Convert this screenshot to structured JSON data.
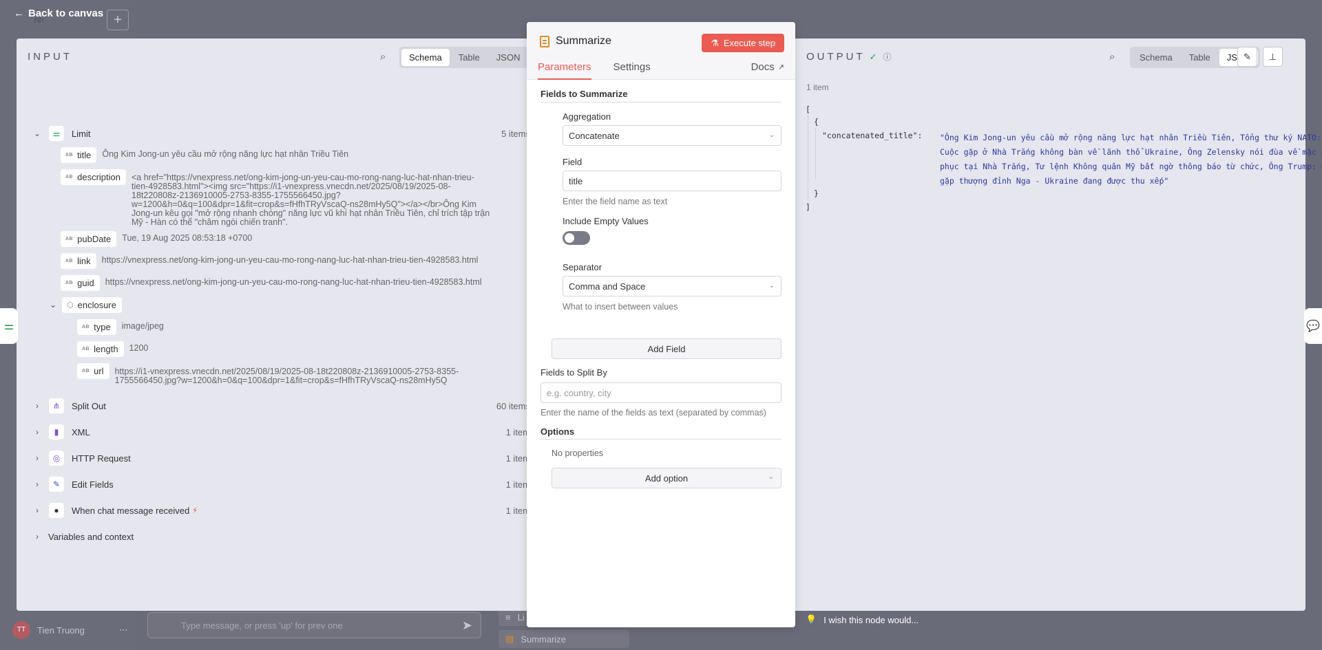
{
  "nav": {
    "back_label": "Back to canvas"
  },
  "background": {
    "left_panel_fragment": "nh",
    "user_name": "Tien Truong",
    "user_initials": "TT",
    "chat_placeholder": "Type message, or press 'up' for prev one",
    "bottom_node_1": "Li",
    "bottom_node_2": "Summarize",
    "wish_text": "I wish this node would..."
  },
  "input": {
    "title": "INPUT",
    "views": [
      "Schema",
      "Table",
      "JSON"
    ],
    "active_view": "Schema",
    "limit": {
      "label": "Limit",
      "count": "5 items"
    },
    "fields": {
      "title": {
        "name": "title",
        "value": "Ông Kim Jong-un yêu cầu mở rộng năng lực hạt nhân Triều Tiên"
      },
      "description": {
        "name": "description",
        "lines": [
          "<a href=\"https://vnexpress.net/ong-kim-jong-un-yeu-cau-mo-rong-nang-luc-hat-nhan-trieu-",
          "tien-4928583.html\"><img src=\"https://i1-vnexpress.vnecdn.net/2025/08/19/2025-08-",
          "18t220808z-2136910005-2753-8355-1755566450.jpg?",
          "w=1200&h=0&q=100&dpr=1&fit=crop&s=fHfhTRyVscaQ-ns28mHy5Q\"></a></br>Ông Kim",
          "Jong-un kêu gọi \"mở rộng nhanh chóng\" năng lực vũ khí hạt nhân Triều Tiên, chỉ trích tập trận",
          "Mỹ - Hàn có thể \"châm ngòi chiến tranh\"."
        ]
      },
      "pubDate": {
        "name": "pubDate",
        "value": "Tue, 19 Aug 2025 08:53:18 +0700"
      },
      "link": {
        "name": "link",
        "value": "https://vnexpress.net/ong-kim-jong-un-yeu-cau-mo-rong-nang-luc-hat-nhan-trieu-tien-4928583.html"
      },
      "guid": {
        "name": "guid",
        "value": "https://vnexpress.net/ong-kim-jong-un-yeu-cau-mo-rong-nang-luc-hat-nhan-trieu-tien-4928583.html"
      },
      "enclosure": {
        "name": "enclosure"
      },
      "type": {
        "name": "type",
        "value": "image/jpeg"
      },
      "length": {
        "name": "length",
        "value": "1200"
      },
      "url": {
        "name": "url",
        "line1": "https://i1-vnexpress.vnecdn.net/2025/08/19/2025-08-18t220808z-2136910005-2753-8355-",
        "line2": "1755566450.jpg?w=1200&h=0&q=100&dpr=1&fit=crop&s=fHfhTRyVscaQ-ns28mHy5Q"
      }
    },
    "nodes": [
      {
        "label": "Split Out",
        "count": "60 items"
      },
      {
        "label": "XML",
        "count": "1 item"
      },
      {
        "label": "HTTP Request",
        "count": "1 item"
      },
      {
        "label": "Edit Fields",
        "count": "1 item"
      },
      {
        "label": "When chat message received",
        "count": "1 item"
      },
      {
        "label": "Variables and context",
        "count": ""
      }
    ],
    "colors": {
      "limit": "#1b9a52",
      "split_out": "#7d4fd6",
      "xml": "#7d4fd6",
      "http": "#7d4fd6",
      "edit": "#3c4fd6",
      "chat": "#333333",
      "trigger": "#ea5c52"
    }
  },
  "params": {
    "node_title": "Summarize",
    "execute_label": "Execute step",
    "tabs": [
      "Parameters",
      "Settings"
    ],
    "docs_label": "Docs",
    "fields_to_summarize": "Fields to Summarize",
    "aggregation_label": "Aggregation",
    "aggregation_value": "Concatenate",
    "field_label": "Field",
    "field_value": "title",
    "field_hint": "Enter the field name as text",
    "include_empty_label": "Include Empty Values",
    "include_empty_on": false,
    "separator_label": "Separator",
    "separator_value": "Comma and Space",
    "separator_hint": "What to insert between values",
    "add_field_label": "Add Field",
    "split_by_label": "Fields to Split By",
    "split_by_placeholder": "e.g. country, city",
    "split_by_hint": "Enter the name of the fields as text (separated by commas)",
    "options_label": "Options",
    "no_properties": "No properties",
    "add_option_label": "Add option"
  },
  "output": {
    "title": "OUTPUT",
    "item_count": "1 item",
    "views": [
      "Schema",
      "Table",
      "JSON"
    ],
    "active_view": "JSON",
    "json_open_bracket": "[",
    "json_open_brace": "{",
    "json_key": "\"concatenated_title\":",
    "json_value_lines": [
      "\"Ông Kim Jong-un yêu cầu mở rộng năng lực hạt nhân Triều Tiên, Tổng thư ký NATO:",
      "Cuộc gặp ở Nhà Trắng không bàn về lãnh thổ Ukraine, Ông Zelensky nói đùa về mặc âu",
      "phục tại Nhà Trắng, Tư lệnh Không quân Mỹ bất ngờ thông báo từ chức, Ông Trump: Cuộc",
      "gặp thượng đỉnh Nga - Ukraine đang được thu xếp\""
    ],
    "json_close_brace": "}",
    "json_close_bracket": "]"
  }
}
